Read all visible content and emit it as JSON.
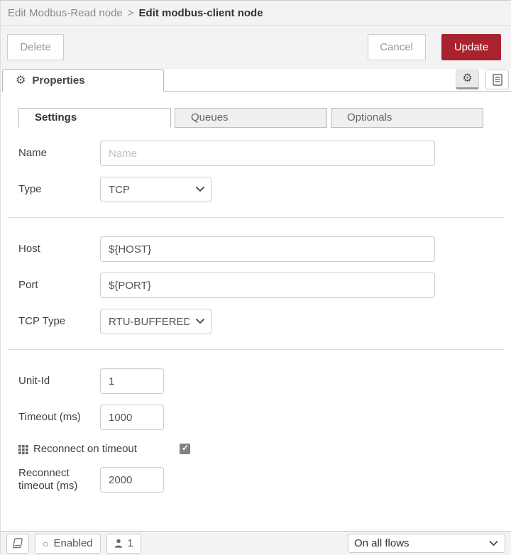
{
  "header": {
    "breadcrumb": {
      "parent": "Edit Modbus-Read node",
      "separator": ">",
      "current": "Edit modbus-client node"
    },
    "delete_label": "Delete",
    "cancel_label": "Cancel",
    "update_label": "Update"
  },
  "editor": {
    "properties_label": "Properties"
  },
  "icons": {
    "gear": "⚙",
    "circle": "○",
    "checkbox_check": "✓"
  },
  "tabs": [
    {
      "label": "Settings",
      "active": true
    },
    {
      "label": "Queues",
      "active": false
    },
    {
      "label": "Optionals",
      "active": false
    }
  ],
  "form": {
    "name": {
      "label": "Name",
      "placeholder": "Name",
      "value": ""
    },
    "type": {
      "label": "Type",
      "value": "TCP"
    },
    "host": {
      "label": "Host",
      "value": "${HOST}"
    },
    "port": {
      "label": "Port",
      "value": "${PORT}"
    },
    "tcp_type": {
      "label": "TCP Type",
      "value": "RTU-BUFFERED"
    },
    "unit_id": {
      "label": "Unit-Id",
      "value": "1"
    },
    "timeout": {
      "label": "Timeout (ms)",
      "value": "1000"
    },
    "reconnect_on_timeout": {
      "label": "Reconnect on timeout",
      "checked": true
    },
    "reconnect_timeout": {
      "label": "Reconnect timeout (ms)",
      "value": "2000"
    }
  },
  "footer": {
    "enabled_label": "Enabled",
    "user_count": "1",
    "scope_value": "On all flows"
  },
  "colors": {
    "update_red": "#a8232e",
    "toolbar_bg": "#f3f3f3",
    "inactive_tab_bg": "#efefef",
    "border": "#cccccc"
  }
}
